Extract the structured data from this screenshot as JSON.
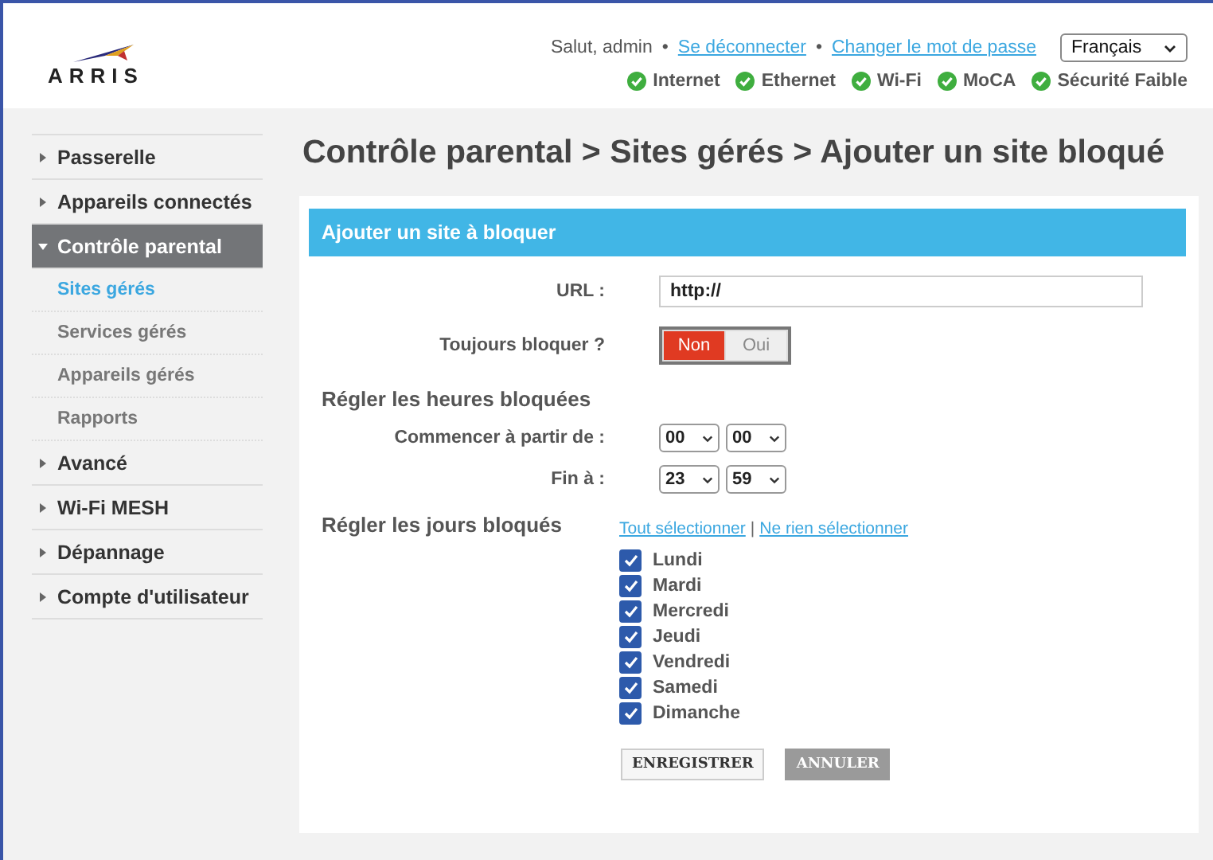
{
  "header": {
    "logo": "ARRIS",
    "greeting": "Salut, admin",
    "links": [
      "Se déconnecter",
      "Changer le mot de passe"
    ],
    "separator": "•",
    "language": "Français",
    "status": [
      {
        "label": "Internet",
        "ok": true
      },
      {
        "label": "Ethernet",
        "ok": true
      },
      {
        "label": "Wi-Fi",
        "ok": true
      },
      {
        "label": "MoCA",
        "ok": true
      },
      {
        "label": "Sécurité Faible",
        "ok": true
      }
    ]
  },
  "sidebar": {
    "items": [
      {
        "label": "Passerelle",
        "expanded": false,
        "selected": false
      },
      {
        "label": "Appareils connectés",
        "expanded": false,
        "selected": false
      },
      {
        "label": "Contrôle parental",
        "expanded": true,
        "selected": true,
        "children": [
          {
            "label": "Sites gérés",
            "selected": true
          },
          {
            "label": "Services gérés",
            "selected": false
          },
          {
            "label": "Appareils gérés",
            "selected": false
          },
          {
            "label": "Rapports",
            "selected": false
          }
        ]
      },
      {
        "label": "Avancé",
        "expanded": false,
        "selected": false
      },
      {
        "label": "Wi-Fi MESH",
        "expanded": false,
        "selected": false
      },
      {
        "label": "Dépannage",
        "expanded": false,
        "selected": false
      },
      {
        "label": "Compte d'utilisateur",
        "expanded": false,
        "selected": false
      }
    ]
  },
  "page_title": "Contrôle parental > Sites gérés > Ajouter un site bloqué",
  "form": {
    "title": "Ajouter un site à bloquer",
    "url": {
      "label": "URL :",
      "value": "http://"
    },
    "always_block": {
      "label": "Toujours bloquer ?",
      "options": [
        {
          "label": "Non",
          "selected": true
        },
        {
          "label": "Oui",
          "selected": false
        }
      ]
    },
    "hours_heading": "Régler les heures bloquées",
    "start": {
      "label": "Commencer à partir de :",
      "hour": "00",
      "minute": "00"
    },
    "end": {
      "label": "Fin à :",
      "hour": "23",
      "minute": "59"
    },
    "days_heading": "Régler les jours bloqués",
    "select_all": "Tout sélectionner",
    "select_separator": "|",
    "select_none": "Ne rien sélectionner",
    "days": [
      {
        "label": "Lundi",
        "checked": true
      },
      {
        "label": "Mardi",
        "checked": true
      },
      {
        "label": "Mercredi",
        "checked": true
      },
      {
        "label": "Jeudi",
        "checked": true
      },
      {
        "label": "Vendredi",
        "checked": true
      },
      {
        "label": "Samedi",
        "checked": true
      },
      {
        "label": "Dimanche",
        "checked": true
      }
    ],
    "buttons": [
      "ENREGISTRER",
      "ANNULER"
    ]
  }
}
